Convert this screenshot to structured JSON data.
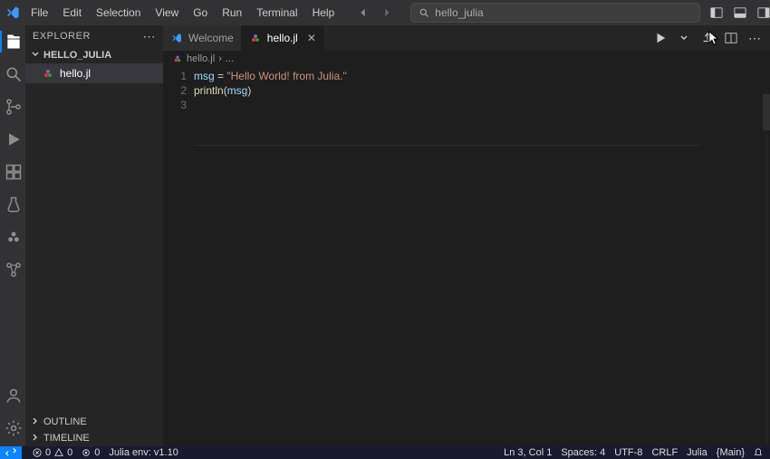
{
  "menus": {
    "file": "File",
    "edit": "Edit",
    "selection": "Selection",
    "view": "View",
    "go": "Go",
    "run": "Run",
    "terminal": "Terminal",
    "help": "Help"
  },
  "search": {
    "placeholder": "hello_julia"
  },
  "icons": {
    "layout_sidebar_left": "layout-sidebar-left-icon",
    "layout_panel": "layout-panel-icon",
    "layout_sidebar_right": "layout-sidebar-right-icon",
    "customize_layout": "customize-layout-icon",
    "minimize": "minimize-icon",
    "maximize": "maximize-icon",
    "close": "close-icon"
  },
  "activity": {
    "items": [
      {
        "name": "explorer",
        "active": true
      },
      {
        "name": "search",
        "active": false
      },
      {
        "name": "source-control",
        "active": false
      },
      {
        "name": "run-and-debug",
        "active": false
      },
      {
        "name": "extensions",
        "active": false
      },
      {
        "name": "testing",
        "active": false
      },
      {
        "name": "julia-workspace",
        "active": false
      },
      {
        "name": "remote-explorer",
        "active": false
      }
    ],
    "bottom": [
      {
        "name": "accounts"
      },
      {
        "name": "manage"
      }
    ]
  },
  "sidebar": {
    "title": "EXPLORER",
    "folder": "HELLO_JULIA",
    "files": [
      {
        "name": "hello.jl",
        "icon": "julia-file-icon",
        "selected": true
      }
    ],
    "sections": {
      "outline": "OUTLINE",
      "timeline": "TIMELINE"
    }
  },
  "tabs": [
    {
      "label": "Welcome",
      "icon": "vscode-icon",
      "active": false,
      "closable": false
    },
    {
      "label": "hello.jl",
      "icon": "julia-file-icon",
      "active": true,
      "closable": true
    }
  ],
  "editor_actions": {
    "run": "run-icon",
    "split": "split-editor-icon",
    "more": "more-icon",
    "run_dropdown": "chevron-down-icon",
    "launch": "launch-icon"
  },
  "breadcrumb": {
    "file": "hello.jl",
    "more": "..."
  },
  "code": {
    "lines": [
      {
        "n": "1",
        "html": "<span class='tok-var'>msg</span> <span class='tok-op'>=</span> <span class='tok-str'>\"Hello World! from Julia.\"</span>"
      },
      {
        "n": "2",
        "html": "<span class='tok-func'>println</span><span class='tok-punct'>(</span><span class='tok-var'>msg</span><span class='tok-punct'>)</span>"
      },
      {
        "n": "3",
        "html": ""
      }
    ]
  },
  "status": {
    "errors": "0",
    "warnings": "0",
    "ports": "0",
    "julia_env": "Julia env: v1.10",
    "cursor": "Ln 3, Col 1",
    "spaces": "Spaces: 4",
    "encoding": "UTF-8",
    "eol": "CRLF",
    "language": "Julia",
    "mode": "{Main}",
    "notifications": "notifications-icon"
  },
  "cursor_tooltip": ""
}
